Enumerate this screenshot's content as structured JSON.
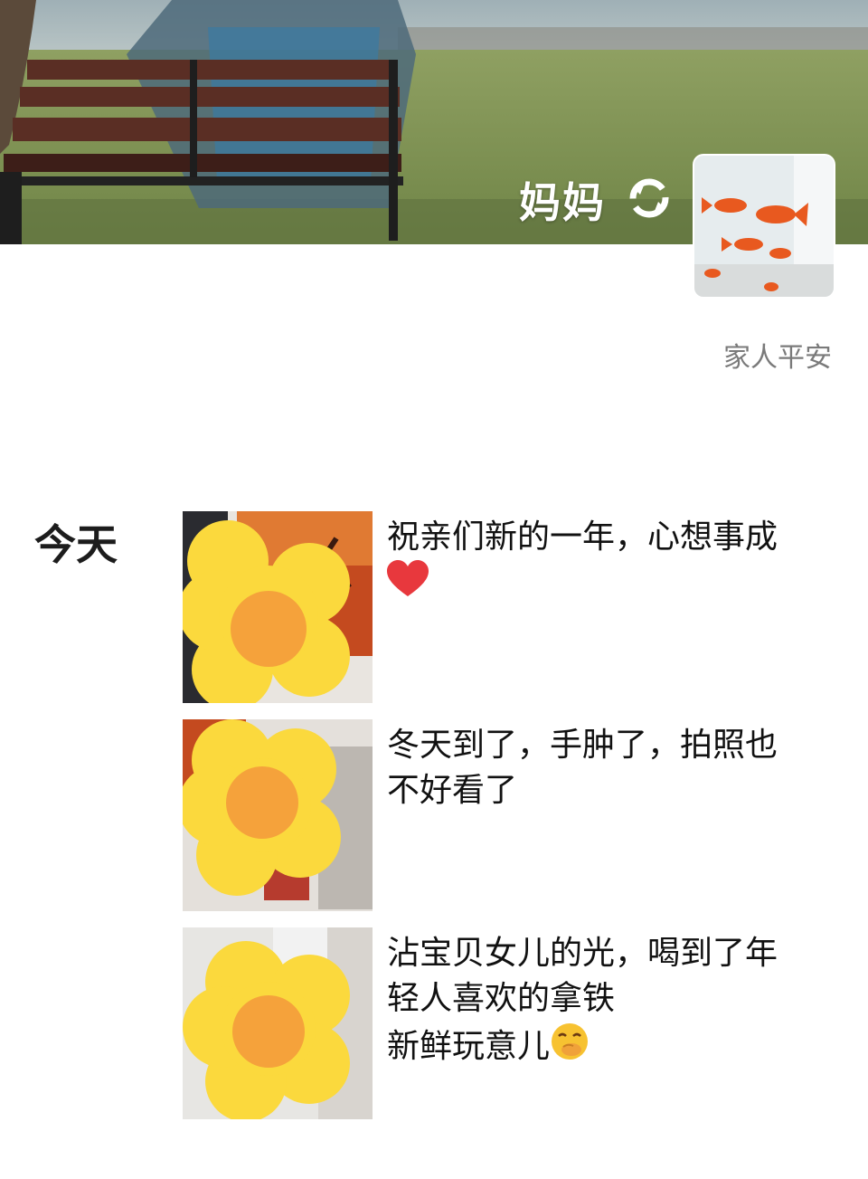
{
  "profile": {
    "name": "妈妈",
    "signature": "家人平安",
    "avatar_icon": "goldfish-photo",
    "refresh_icon": "refresh-icon"
  },
  "timeline": {
    "date_label": "今天",
    "posts": [
      {
        "lines": [
          "祝亲们新的一年，心想事成"
        ],
        "emoji": "red-heart",
        "thumb": "photo-flower-sticker"
      },
      {
        "lines": [
          "冬天到了，手肿了，拍照也",
          "不好看了"
        ],
        "thumb": "photo-flower-sticker"
      },
      {
        "lines": [
          "沾宝贝女儿的光，喝到了年",
          "轻人喜欢的拿铁",
          "新鲜玩意儿"
        ],
        "emoji": "hand-over-mouth-face",
        "thumb": "photo-flower-sticker"
      }
    ]
  },
  "colors": {
    "flower_petal": "#fbd93d",
    "flower_center": "#f5a23b",
    "signature_gray": "#7a7a7a"
  }
}
